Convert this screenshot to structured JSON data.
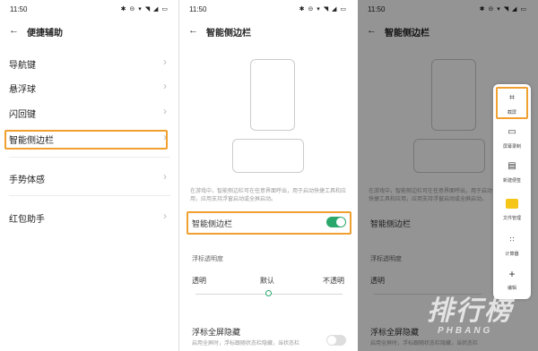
{
  "status_bar": {
    "time": "11:50",
    "icons": "✱ ⊝ ▾ ◥ ◢ ▭"
  },
  "panel1": {
    "title": "便捷辅助",
    "items": [
      {
        "label": "导航键"
      },
      {
        "label": "悬浮球"
      },
      {
        "label": "闪回键"
      },
      {
        "label": "智能侧边栏"
      },
      {
        "label": "手势体感"
      },
      {
        "label": "红包助手"
      }
    ],
    "chevron": "›"
  },
  "panel2": {
    "title": "智能侧边栏",
    "description": "在游戏中，智能侧边栏可在任意界面呼出，用于启动快捷工具和应用，应用支持浮窗启动或全屏启动。",
    "toggle_label": "智能侧边栏",
    "toggle_on": true,
    "opacity_label": "浮标透明度",
    "opacity_left": "透明",
    "opacity_mid": "默认",
    "opacity_right": "不透明",
    "opacity_value": 0.5,
    "fullscreen_label": "浮标全屏隐藏",
    "fullscreen_desc": "启用全屏时，浮标跟随状态栏隐藏，当状态栏",
    "fullscreen_on": false
  },
  "panel3": {
    "title": "智能侧边栏",
    "description": "在游戏中，智能侧边栏可在任意界面呼出，用于启动快捷工具和应用，应用支持浮窗启动或全屏启动。",
    "toggle_label": "智能侧边栏",
    "opacity_label": "浮标透明度",
    "opacity_left": "透明",
    "fullscreen_label": "浮标全屏隐藏",
    "fullscreen_desc": "启用全屏时，浮标跟随状态栏隐藏，当状态栏",
    "sidebar_items": [
      {
        "label": "截屏",
        "icon": "crop-icon"
      },
      {
        "label": "屏幕录制",
        "icon": "video-icon"
      },
      {
        "label": "新建便签",
        "icon": "note-icon"
      },
      {
        "label": "文件管理",
        "icon": "folder-icon"
      },
      {
        "label": "计算器",
        "icon": "calculator-icon"
      },
      {
        "label": "编辑",
        "icon": "plus-icon"
      }
    ]
  },
  "watermark": {
    "main": "排行榜",
    "sub": "PHBANG"
  },
  "colors": {
    "highlight": "#f0a030",
    "accent": "#2aa76a",
    "folder": "#f5c518"
  }
}
